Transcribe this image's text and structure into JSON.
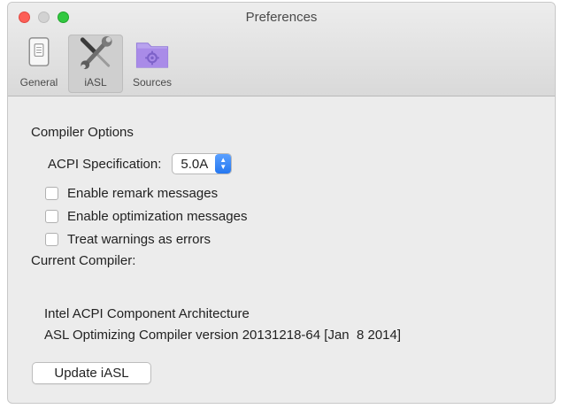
{
  "window": {
    "title": "Preferences"
  },
  "toolbar": {
    "items": [
      {
        "label": "General",
        "icon": "switch-icon",
        "selected": false
      },
      {
        "label": "iASL",
        "icon": "tools-icon",
        "selected": true
      },
      {
        "label": "Sources",
        "icon": "folder-gear-icon",
        "selected": false
      }
    ]
  },
  "compiler_options": {
    "title": "Compiler Options",
    "acpi_label": "ACPI Specification:",
    "acpi_value": "5.0A",
    "checkboxes": [
      {
        "label": "Enable remark messages",
        "checked": false
      },
      {
        "label": "Enable optimization messages",
        "checked": false
      },
      {
        "label": "Treat warnings as errors",
        "checked": false
      }
    ]
  },
  "current_compiler": {
    "title": "Current Compiler:",
    "line1": "Intel ACPI Component Architecture",
    "line2": "ASL Optimizing Compiler version 20131218-64 [Jan  8 2014]"
  },
  "update_button": {
    "label": "Update iASL"
  },
  "colors": {
    "accent": "#2577f0",
    "close": "#fc5f57",
    "zoom": "#32c840",
    "folder": "#a98be8"
  }
}
